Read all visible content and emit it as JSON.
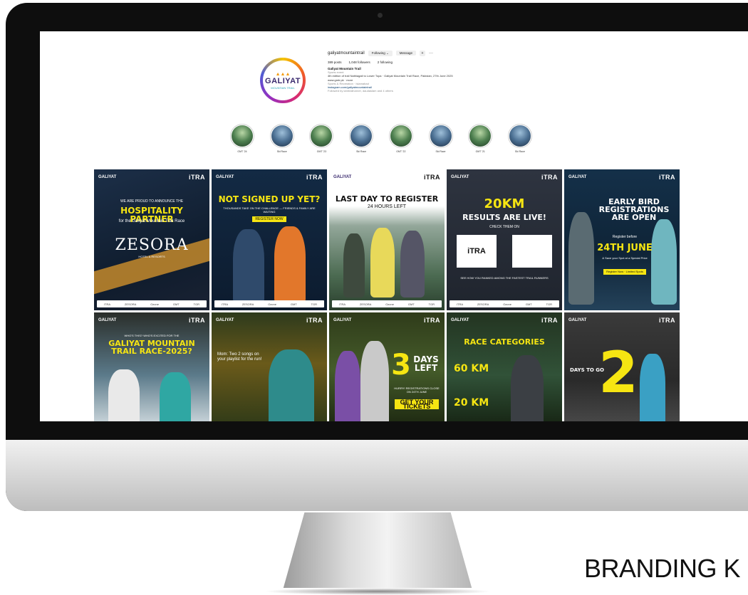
{
  "profile": {
    "username": "galiyatmountaintrail",
    "follow_label": "Following ⌄",
    "message_label": "Message",
    "more_label": "···",
    "posts": "389 posts",
    "followers": "1,048 followers",
    "following": "2 following",
    "name": "Galiyat Mountain Trail",
    "category": "Sports event",
    "bio_line": "4th edition of trail Nathiagali to Lower Topa · Galiyat Mountain Trail Race, Pakistan, 27th June 2025",
    "bio_line2": "www.gmtr.pk · more",
    "bio_line3": "Sports & Recreation · Islamabad",
    "link": "instagram.com/galiyatmountaintrail",
    "followed_by": "Followed by iamtrailrunner, daudaslam and 4 others",
    "logo_text": "GALIYAT",
    "logo_sub": "MOUNTAIN TRAIL",
    "logo_peaks": "▲▲▲"
  },
  "highlights": [
    {
      "label": "GMT '24"
    },
    {
      "label": "Ski Race"
    },
    {
      "label": "GMT '23"
    },
    {
      "label": "Ski Race"
    },
    {
      "label": "GMT '22"
    },
    {
      "label": "Ski Race"
    },
    {
      "label": "GMT '21"
    },
    {
      "label": "Ski Race"
    }
  ],
  "posts": {
    "brand": "GALIYAT",
    "itra": "iTRA",
    "sponsors": [
      "ITRA",
      "ZESORA",
      "Ozone",
      "GMT",
      "TGR",
      "PMC"
    ],
    "p1": {
      "intro": "WE ARE PROUD TO ANNOUNCE THE",
      "headline": "HOSPITALITY PARTNER",
      "line": "for the Galiyat Mountain Trail Race",
      "brand": "ZESORA",
      "brand_sub": "HOTEL & RESORTS"
    },
    "p2": {
      "headline": "NOT SIGNED UP YET?",
      "sub": "THOUSANDS TAKE ON THE CHALLENGE — FRIENDS & FAMILY ARE WAITING",
      "cta": "REGISTER NOW"
    },
    "p3": {
      "headline": "LAST DAY TO REGISTER",
      "sub": "24 HOURS LEFT"
    },
    "p4": {
      "headline": "20KM",
      "headline2": "RESULTS ARE LIVE!",
      "sub": "CHECK THEM ON",
      "sub2": "SEE HOW YOU RANKED AMONG THE FASTEST TRAIL RUNNERS",
      "itra": "iTRA"
    },
    "p5": {
      "headline": "EARLY BIRD REGISTRATIONS ARE OPEN",
      "sub": "Register before",
      "date": "24TH JUNE",
      "sub2": "& Save your Spot at a Special Price",
      "cta": "Register Now · Limited Spots"
    },
    "p6": {
      "sub": "WHO'S THIS? WHO'S EXCITED FOR THE",
      "headline": "GALIYAT MOUNTAIN TRAIL RACE-2025?"
    },
    "p7": {
      "sub": "Mom: Two 2 songs on your playlist for the run!"
    },
    "p8": {
      "headline": "3",
      "headline2": "DAYS LEFT",
      "sub": "HURRY! REGISTRATIONS CLOSE ON 24TH JUNE",
      "cta": "GET YOUR TICKETS"
    },
    "p9": {
      "headline": "RACE CATEGORIES",
      "cat1": "60 KM",
      "cat2": "20 KM"
    },
    "p10": {
      "sub": "DAYS TO GO",
      "headline": "2"
    }
  },
  "page": {
    "branding": "BRANDING K"
  }
}
